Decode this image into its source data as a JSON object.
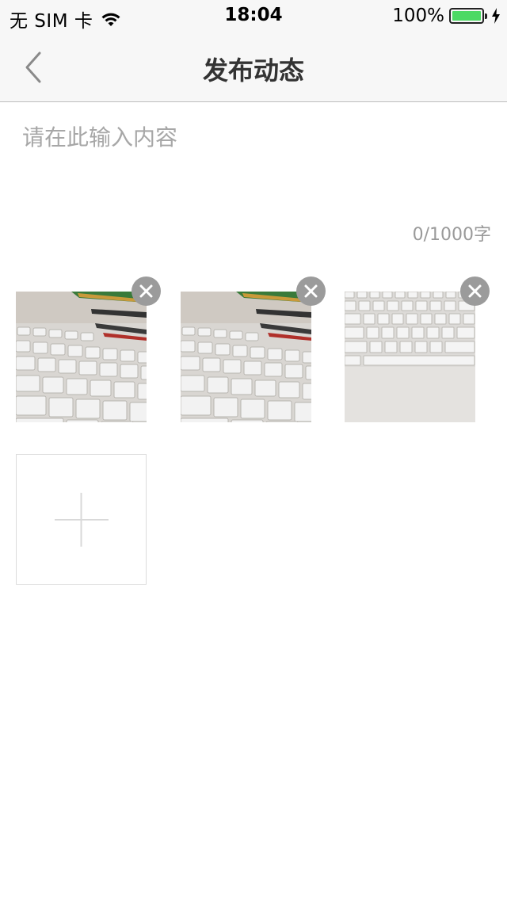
{
  "status_bar": {
    "carrier": "无 SIM 卡",
    "time": "18:04",
    "battery": "100%",
    "battery_level": 1.0,
    "battery_color": "#4cd964"
  },
  "nav": {
    "title": "发布动态",
    "back_icon": "chevron-left-icon"
  },
  "compose": {
    "placeholder": "请在此输入内容",
    "value": "",
    "char_count": "0/1000字"
  },
  "photos": [
    {
      "subject": "keyboard-with-pens",
      "remove_icon": "close-icon"
    },
    {
      "subject": "keyboard-with-pens",
      "remove_icon": "close-icon"
    },
    {
      "subject": "keyboard-top-down",
      "remove_icon": "close-icon"
    }
  ],
  "add_photo": {
    "icon": "plus-icon"
  },
  "colors": {
    "nav_background": "#f7f7f7",
    "title_text": "#333333",
    "placeholder_text": "#a7a7a7",
    "remove_button": "#9b9b9b"
  }
}
